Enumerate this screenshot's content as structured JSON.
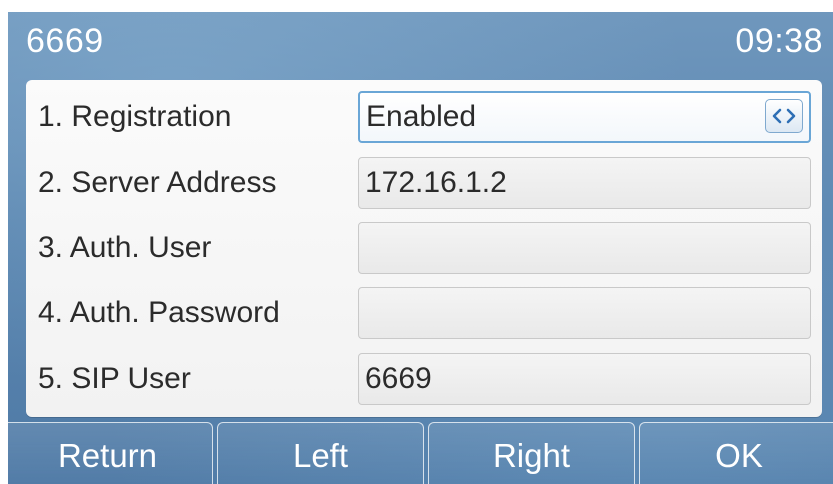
{
  "status": {
    "account": "6669",
    "time": "09:38"
  },
  "settings": [
    {
      "label": "1. Registration",
      "value": "Enabled"
    },
    {
      "label": "2. Server Address",
      "value": "172.16.1.2"
    },
    {
      "label": "3. Auth. User",
      "value": ""
    },
    {
      "label": "4. Auth. Password",
      "value": ""
    },
    {
      "label": "5. SIP User",
      "value": "6669"
    }
  ],
  "softkeys": {
    "return": "Return",
    "left": "Left",
    "right": "Right",
    "ok": "OK"
  },
  "icons": {
    "toggle": "left-right-arrows-icon"
  },
  "colors": {
    "screen_bg": "#5b86b0",
    "accent": "#2e6fb5",
    "selected_border": "#6aa6d6"
  }
}
